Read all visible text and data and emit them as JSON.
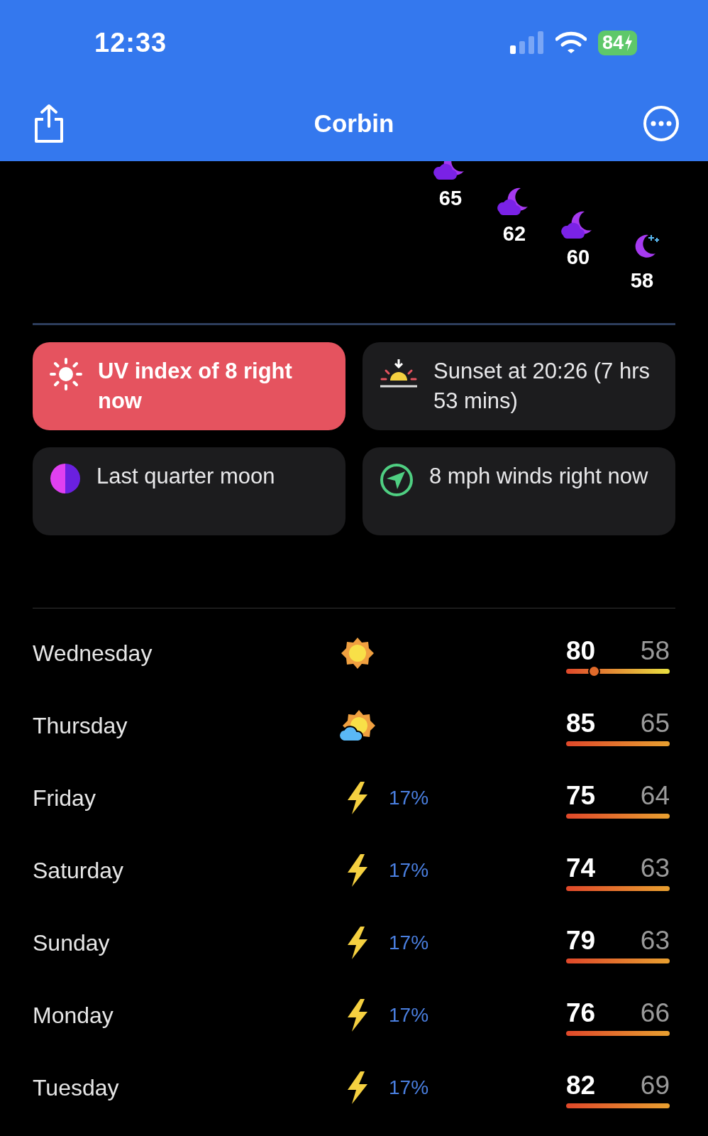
{
  "status_bar": {
    "time": "12:33",
    "battery": "84"
  },
  "nav": {
    "title": "Corbin"
  },
  "hourly": [
    {
      "kind": "partly_cloudy_night",
      "temp": "65"
    },
    {
      "kind": "partly_cloudy_night",
      "temp": "62"
    },
    {
      "kind": "partly_cloudy_night",
      "temp": "60"
    },
    {
      "kind": "clear_night",
      "temp": "58"
    }
  ],
  "cards": [
    {
      "kind": "uv",
      "text": "UV index of 8 right now"
    },
    {
      "kind": "sunset",
      "text": "Sunset at 20:26 (7 hrs 53 mins)"
    },
    {
      "kind": "moon",
      "text": "Last quarter moon"
    },
    {
      "kind": "wind",
      "text": "8 mph winds right now"
    }
  ],
  "days": [
    {
      "day": "Wednesday",
      "kind": "sunny",
      "high": "80",
      "low": "58",
      "level": 0.27
    },
    {
      "day": "Thursday",
      "kind": "partly_cloudy",
      "high": "85",
      "low": "65"
    },
    {
      "day": "Friday",
      "kind": "storm",
      "precip": "17%",
      "high": "75",
      "low": "64"
    },
    {
      "day": "Saturday",
      "kind": "storm",
      "precip": "17%",
      "high": "74",
      "low": "63"
    },
    {
      "day": "Sunday",
      "kind": "storm",
      "precip": "17%",
      "high": "79",
      "low": "63"
    },
    {
      "day": "Monday",
      "kind": "storm",
      "precip": "17%",
      "high": "76",
      "low": "66"
    },
    {
      "day": "Tuesday",
      "kind": "storm",
      "precip": "17%",
      "high": "82",
      "low": "69"
    }
  ]
}
